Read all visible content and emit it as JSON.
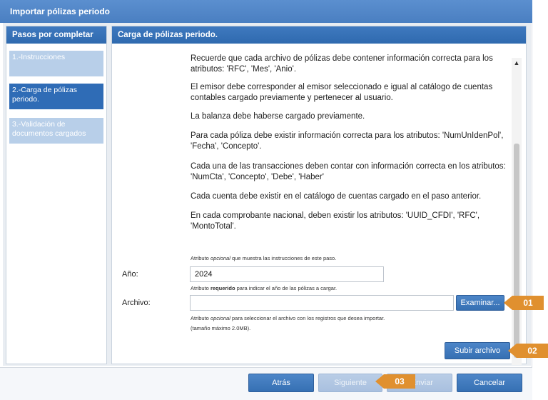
{
  "window": {
    "title": "Importar pólizas periodo"
  },
  "sidebar": {
    "title": "Pasos por completar",
    "steps": [
      {
        "label": "1.-Instrucciones"
      },
      {
        "label": "2.-Carga de pólizas periodo."
      },
      {
        "label": "3.-Validación de documentos cargados"
      }
    ]
  },
  "main": {
    "title": "Carga de pólizas periodo.",
    "paragraphs": [
      "Recuerde que cada archivo de pólizas debe contener información correcta para los atributos: 'RFC', 'Mes', 'Anio'.",
      "El emisor debe corresponder al emisor seleccionado e igual al catálogo de cuentas contables cargado previamente y pertenecer al usuario.",
      "La balanza debe haberse cargado previamente.",
      "Para cada póliza debe existir información correcta para los atributos: 'NumUnIdenPol', 'Fecha', 'Concepto'.",
      "Cada una de las transacciones deben contar con información correcta en los atributos: 'NumCta', 'Concepto', 'Debe', 'Haber'",
      "Cada cuenta debe existir en el catálogo de cuentas cargado en el paso anterior.",
      "En cada comprobante nacional, deben existir los atributos: 'UUID_CFDI', 'RFC', 'MontoTotal'."
    ],
    "hint_instructions": {
      "pre": "Atributo ",
      "em": "opcional",
      "post": " que muestra las instrucciones de este paso."
    },
    "year": {
      "label": "Año:",
      "value": "2024",
      "hint_pre": "Atributo ",
      "hint_strong": "requerido",
      "hint_post": " para indicar el año de las pólizas a cargar."
    },
    "file": {
      "label": "Archivo:",
      "value": "",
      "browse_label": "Examinar...",
      "hint_pre": "Atributo ",
      "hint_em": "opcional",
      "hint_post": " para seleccionar el archivo con los registros que desea importar.",
      "size_note": "(tamaño máximo 2.0MB)."
    },
    "upload_label": "Subir archivo"
  },
  "footer": {
    "back_label": "Atrás",
    "next_label": "Siguiente",
    "send_label": "Enviar",
    "cancel_label": "Cancelar"
  },
  "callouts": [
    "01",
    "02",
    "03"
  ],
  "colors": {
    "primary": "#3670b3",
    "callout": "#e0902f"
  }
}
